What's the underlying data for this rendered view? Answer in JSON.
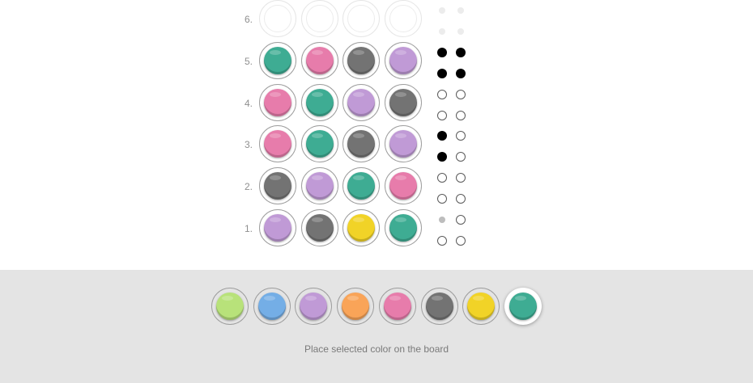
{
  "board": {
    "rows": [
      {
        "label": "6.",
        "pegs": [
          null,
          null,
          null,
          null
        ],
        "feedback": [
          "future",
          "future",
          "future",
          "future"
        ]
      },
      {
        "label": "5.",
        "pegs": [
          "teal",
          "pink",
          "gray",
          "purple"
        ],
        "feedback": [
          "black",
          "black",
          "black",
          "black"
        ]
      },
      {
        "label": "4.",
        "pegs": [
          "pink",
          "teal",
          "purple",
          "gray"
        ],
        "feedback": [
          "white",
          "white",
          "white",
          "white"
        ]
      },
      {
        "label": "3.",
        "pegs": [
          "pink",
          "teal",
          "gray",
          "purple"
        ],
        "feedback": [
          "black",
          "white",
          "black",
          "white"
        ]
      },
      {
        "label": "2.",
        "pegs": [
          "gray",
          "purple",
          "teal",
          "pink"
        ],
        "feedback": [
          "white",
          "white",
          "white",
          "white"
        ]
      },
      {
        "label": "1.",
        "pegs": [
          "purple",
          "gray",
          "yellow",
          "teal"
        ],
        "feedback": [
          "none",
          "white",
          "white",
          "white"
        ]
      }
    ]
  },
  "colors": {
    "green": "#b8e27a",
    "blue": "#74aee6",
    "purple": "#c09ad6",
    "orange": "#f9a458",
    "pink": "#e77cab",
    "gray": "#737373",
    "yellow": "#f1d327",
    "teal": "#3eac93"
  },
  "palette": {
    "swatches": [
      "green",
      "blue",
      "purple",
      "orange",
      "pink",
      "gray",
      "yellow",
      "teal"
    ],
    "selected": "teal",
    "hint": "Place selected color on the board"
  }
}
